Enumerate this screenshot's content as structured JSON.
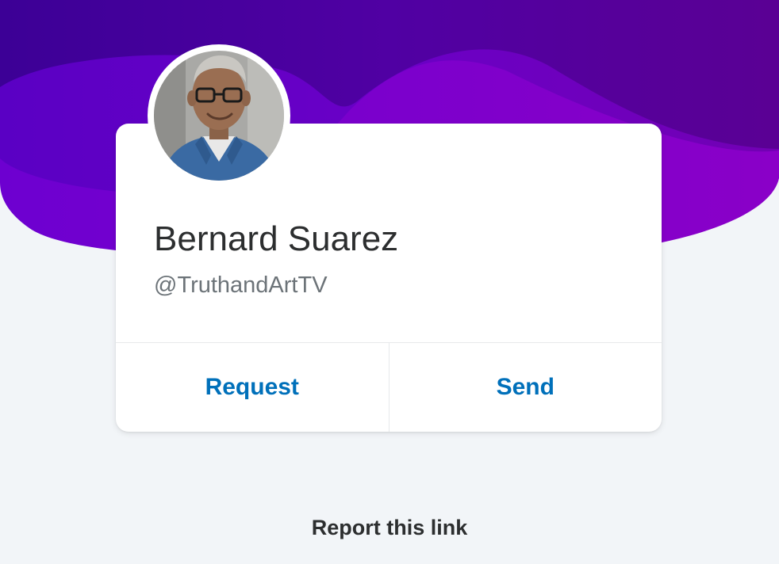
{
  "profile": {
    "name": "Bernard Suarez",
    "handle": "@TruthandArtTV",
    "avatar_icon": "person-photo"
  },
  "actions": {
    "request_label": "Request",
    "send_label": "Send"
  },
  "footer": {
    "report_label": "Report this link"
  },
  "colors": {
    "brand_purple_dark": "#3d0094",
    "brand_purple": "#6a00c8",
    "link_blue": "#0070ba",
    "text_dark": "#2c2e2f",
    "text_muted": "#6c7378",
    "page_bg": "#f2f5f8"
  }
}
